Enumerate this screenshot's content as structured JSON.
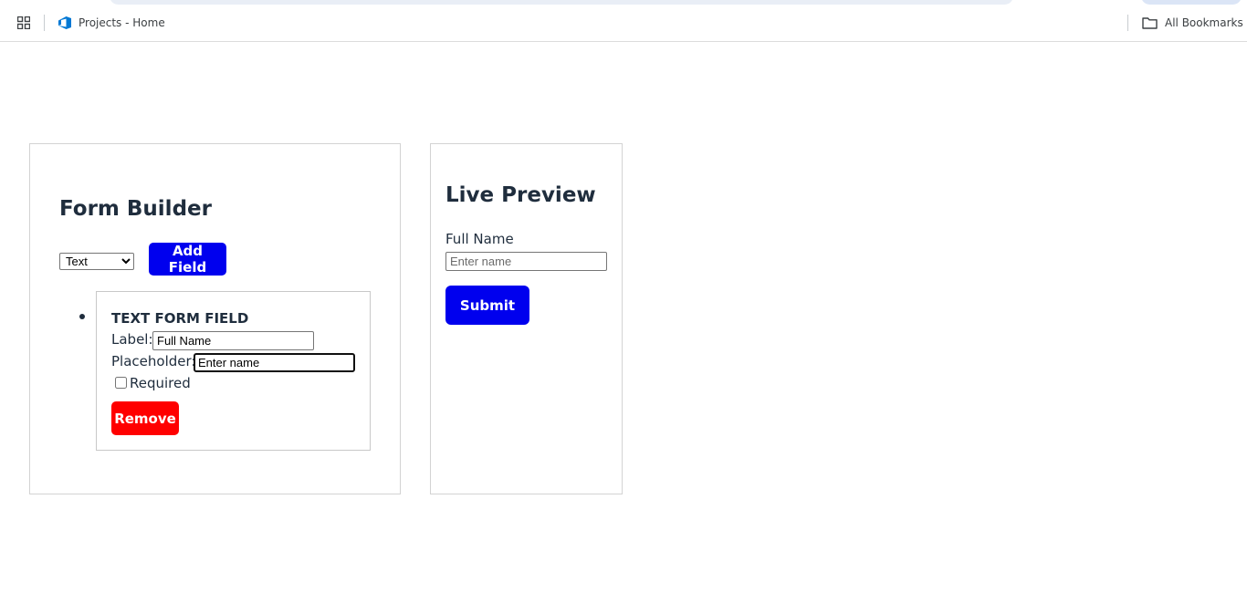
{
  "browser": {
    "bookmark_label": "Projects - Home",
    "all_bookmarks_label": "All Bookmarks"
  },
  "builder": {
    "title": "Form Builder",
    "type_select": {
      "selected": "Text"
    },
    "add_field_label": "Add Field",
    "fields": [
      {
        "heading": "TEXT FORM FIELD",
        "label_caption": "Label:",
        "label_value": "Full Name",
        "placeholder_caption": "Placeholder:",
        "placeholder_value": "Enter name",
        "required_caption": "Required",
        "required_checked": false,
        "remove_label": "Remove"
      }
    ]
  },
  "preview": {
    "title": "Live Preview",
    "field_label": "Full Name",
    "field_placeholder": "Enter name",
    "submit_label": "Submit"
  },
  "colors": {
    "primary_button": "#0000ee",
    "danger_button": "#ff0000",
    "heading_text": "#1f2d3d"
  }
}
